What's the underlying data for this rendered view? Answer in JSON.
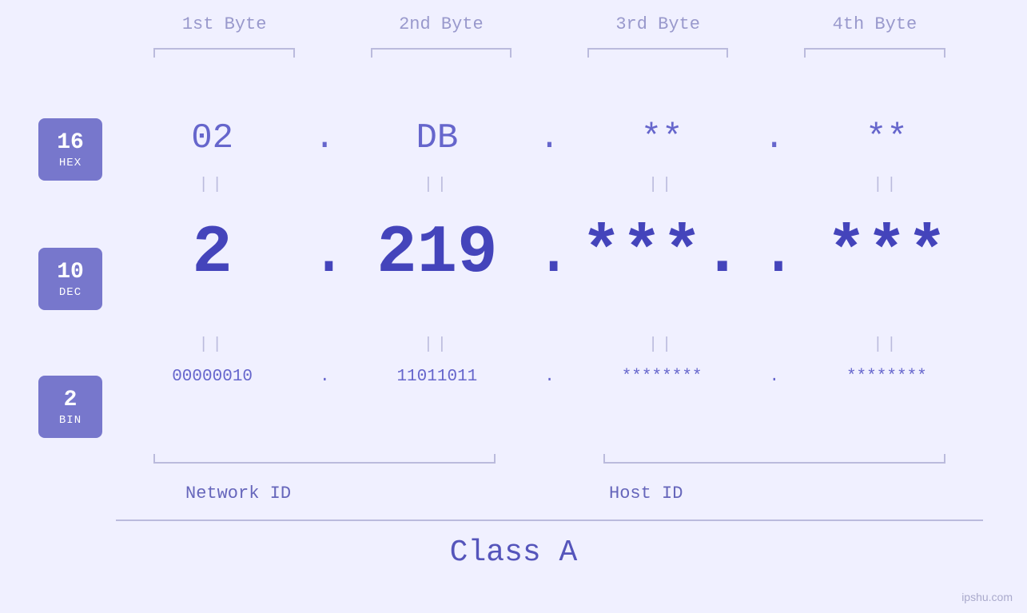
{
  "page": {
    "background": "#f0f0ff",
    "watermark": "ipshu.com"
  },
  "byteHeaders": {
    "b1": "1st Byte",
    "b2": "2nd Byte",
    "b3": "3rd Byte",
    "b4": "4th Byte"
  },
  "badges": {
    "hex": {
      "number": "16",
      "label": "HEX"
    },
    "dec": {
      "number": "10",
      "label": "DEC"
    },
    "bin": {
      "number": "2",
      "label": "BIN"
    }
  },
  "hex": {
    "b1": "02",
    "b2": "DB",
    "b3": "**",
    "b4": "**",
    "dot": "."
  },
  "dec": {
    "b1": "2",
    "b2": "219.",
    "b3": "***.",
    "b4": "***",
    "dot1": ".",
    "dot2": ".",
    "dot3": ".",
    "dot4": "."
  },
  "bin": {
    "b1": "00000010",
    "b2": "11011011",
    "b3": "********",
    "b4": "********",
    "dot": "."
  },
  "equals": "||",
  "labels": {
    "networkId": "Network ID",
    "hostId": "Host ID",
    "classA": "Class A"
  }
}
